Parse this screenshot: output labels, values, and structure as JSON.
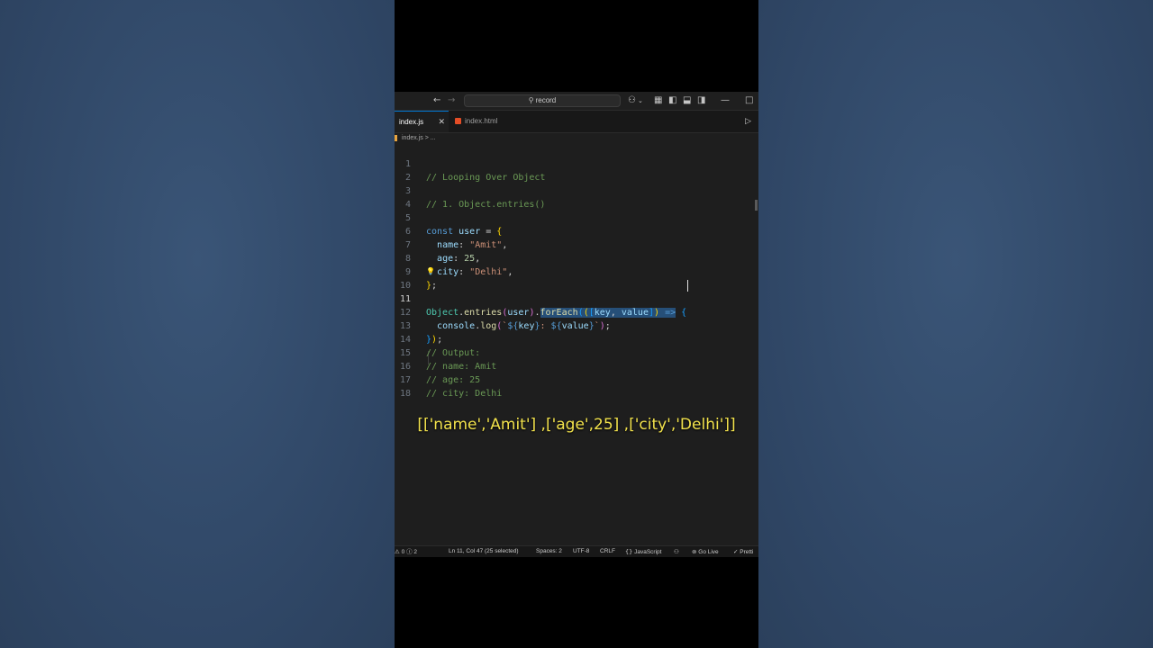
{
  "titlebar": {
    "search_text": "record"
  },
  "tabs": [
    {
      "label": "index.js",
      "active": true
    },
    {
      "label": "index.html",
      "active": false
    }
  ],
  "breadcrumb": {
    "file": "index.js",
    "separator": ">",
    "more": "..."
  },
  "code_lines": [
    {
      "n": "1",
      "text": "// Looping Over Object"
    },
    {
      "n": "2",
      "text": ""
    },
    {
      "n": "3",
      "text": "// 1. Object.entries()"
    },
    {
      "n": "4",
      "text": ""
    },
    {
      "n": "5",
      "text": "const user = {"
    },
    {
      "n": "6",
      "text": "  name: \"Amit\","
    },
    {
      "n": "7",
      "text": "  age: 25,"
    },
    {
      "n": "8",
      "text": "  city: \"Delhi\","
    },
    {
      "n": "9",
      "text": "};"
    },
    {
      "n": "10",
      "text": ""
    },
    {
      "n": "11",
      "text": "Object.entries(user).forEach(([key, value]) => {"
    },
    {
      "n": "12",
      "text": "  console.log(`${key}: ${value}`);"
    },
    {
      "n": "13",
      "text": "});"
    },
    {
      "n": "14",
      "text": "// Output:"
    },
    {
      "n": "15",
      "text": "// name: Amit"
    },
    {
      "n": "16",
      "text": "// age: 25"
    },
    {
      "n": "17",
      "text": "// city: Delhi"
    },
    {
      "n": "18",
      "text": ""
    }
  ],
  "selection_text": "forEach(([key, value]) =>",
  "caption": "[['name','Amit'] ,['age',25] ,['city','Delhi']]",
  "statusbar": {
    "errors": "0",
    "warnings": "2",
    "position": "Ln 11, Col 47 (25 selected)",
    "spaces": "Spaces: 2",
    "encoding": "UTF-8",
    "eol": "CRLF",
    "language": "JavaScript",
    "golive": "Go Live",
    "prettier": "Pretti"
  },
  "colors": {
    "accent": "#0078d4",
    "caption": "#f2e24c",
    "selection": "#264f78"
  }
}
